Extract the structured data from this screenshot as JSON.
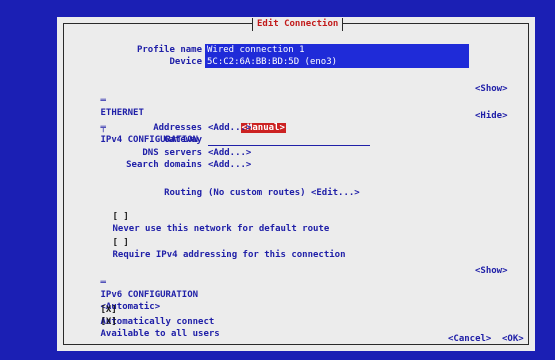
{
  "dialog": {
    "title": "Edit Connection",
    "profile_name_label": "Profile name",
    "profile_name_value": "Wired connection 1",
    "device_label": "Device",
    "device_value": "5C:C2:6A:BB:BD:5D (eno3)"
  },
  "ethernet": {
    "marker": "═",
    "heading": "ETHERNET",
    "toggle": "<Show>"
  },
  "ipv4": {
    "marker": "╤",
    "heading": "IPv4 CONFIGURATION",
    "method": "<Manual>",
    "toggle": "<Hide>",
    "addresses_label": "Addresses",
    "addresses_value": "<Add...>",
    "gateway_label": "Gateway",
    "dns_label": "DNS servers",
    "dns_value": "<Add...>",
    "search_label": "Search domains",
    "search_value": "<Add...>",
    "routing_label": "Routing",
    "routing_value": "(No custom routes) <Edit...>",
    "never_default_check": "[ ]",
    "never_default_label": "Never use this network for default route",
    "require_check": "[ ]",
    "require_label": "Require IPv4 addressing for this connection"
  },
  "ipv6": {
    "marker": "═",
    "heading": "IPv6 CONFIGURATION",
    "method": "<Automatic>",
    "toggle": "<Show>"
  },
  "options": {
    "auto_connect_check": "[X]",
    "auto_connect_label": "Automatically connect",
    "all_users_check": "[X]",
    "all_users_label": "Available to all users"
  },
  "buttons": {
    "cancel": "<Cancel>",
    "ok": "<OK>"
  },
  "colors": {
    "background": "#1b1fb4",
    "dialog": "#ececec",
    "title": "#c21a1a",
    "field": "#1f2bd8",
    "selected": "#cc2222"
  }
}
